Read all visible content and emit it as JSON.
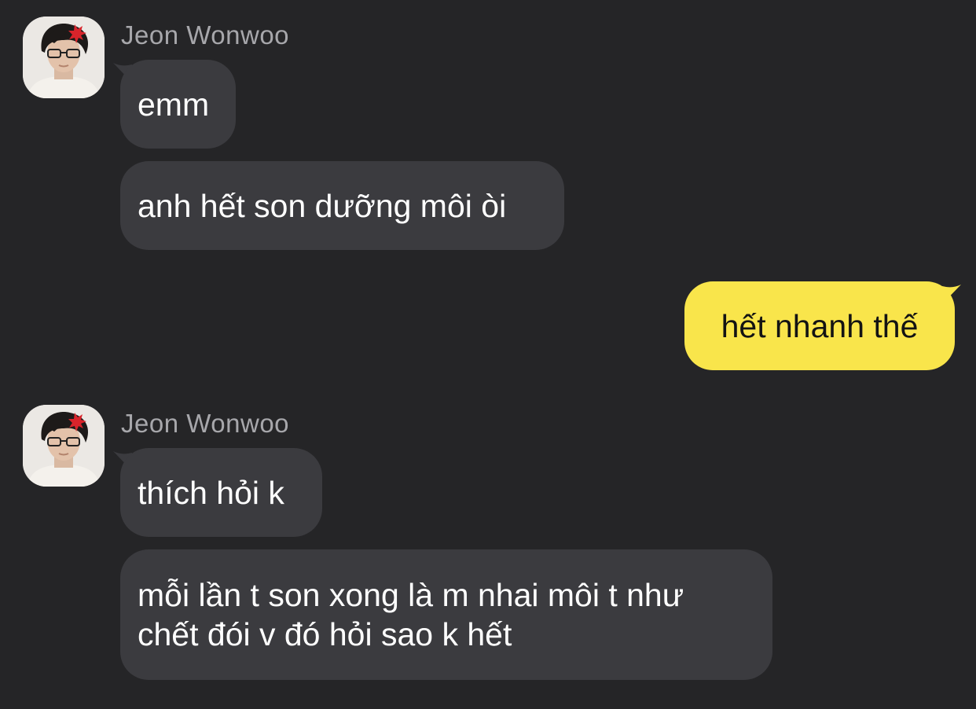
{
  "colors": {
    "background": "#252527",
    "incoming_bubble": "#3b3b3f",
    "outgoing_bubble": "#f9e54b",
    "incoming_text": "#ffffff",
    "outgoing_text": "#131313",
    "sender_name": "#a7a7ab"
  },
  "messages": [
    {
      "sender": "Jeon Wonwoo",
      "avatar_icon": "profile-photo",
      "bubbles": [
        "emm",
        "anh hết son dưỡng môi òi"
      ]
    },
    {
      "sender": "me",
      "bubbles": [
        "hết nhanh thế"
      ]
    },
    {
      "sender": "Jeon Wonwoo",
      "avatar_icon": "profile-photo",
      "bubbles": [
        "thích hỏi k",
        "mỗi lần t son xong là m nhai môi t như chết đói v đó hỏi sao k hết"
      ]
    }
  ]
}
